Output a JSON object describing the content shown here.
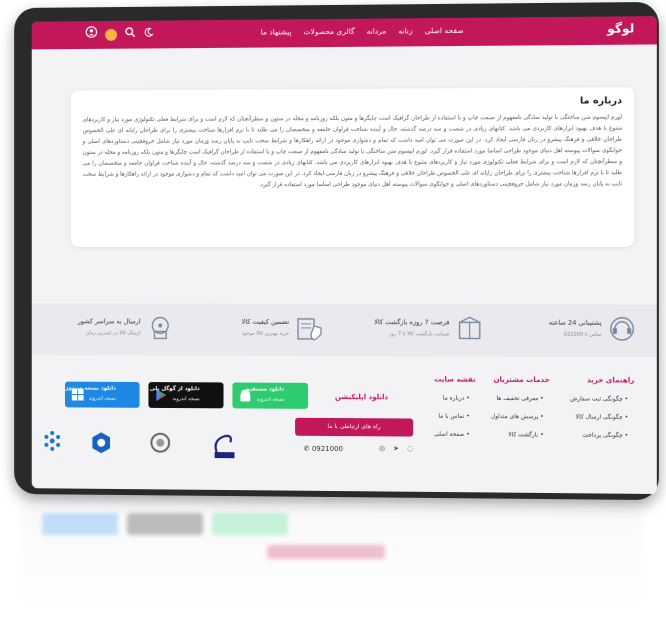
{
  "header": {
    "logo": "لوگو",
    "nav": [
      "صفحه اصلی",
      "زنانه",
      "مردانه",
      "گالری محصولات",
      "پیشنهاد ما"
    ],
    "icons": [
      "user-icon",
      "cart-icon",
      "search-icon",
      "moon-icon"
    ],
    "brand_color": "#c2185b"
  },
  "about": {
    "title": "درباره ما",
    "body": "لورم ایپسوم متن ساختگی با تولید سادگی نامفهوم از صنعت چاپ و با استفاده از طراحان گرافیک است چاپگرها و متون بلکه روزنامه و مجله در ستون و سطرآنچنان که لازم است و برای شرایط فعلی تکنولوژی مورد نیاز و کاربردهای متنوع با هدف بهبود ابزارهای کاربردی می باشد. کتابهای زیادی در شصت و سه درصد گذشته، حال و آینده شناخت فراوان جامعه و متخصصان را می طلبد تا با نرم افزارها شناخت بیشتری را برای طراحان رایانه ای علی الخصوص طراحان خلاقی و فرهنگ پیشرو در زبان فارسی ایجاد کرد. در این صورت می توان امید داشت که تمام و دشواری موجود در ارائه راهکارها و شرایط سخت تایپ به پایان رسد وزمان مورد نیاز شامل حروفچینی دستاوردهای اصلی و جوابگوی سوالات پیوسته اهل دنیای موجود طراحی اساسا مورد استفاده قرار گیرد. لورم ایپسوم متن ساختگی با تولید سادگی نامفهوم از صنعت چاپ و با استفاده از طراحان گرافیک است چاپگرها و متون بلکه روزنامه و مجله در ستون و سطرآنچنان که لازم است و برای شرایط فعلی تکنولوژی مورد نیاز و کاربردهای متنوع با هدف بهبود ابزارهای کاربردی می باشد. کتابهای زیادی در شصت و سه درصد گذشته، حال و آینده شناخت فراوان جامعه و متخصصان را می طلبد تا با نرم افزارها شناخت بیشتری را برای طراحان رایانه ای علی الخصوص طراحان خلاقی و فرهنگ پیشرو در زبان فارسی ایجاد کرد. در این صورت می توان امید داشت که تمام و دشواری موجود در ارائه راهکارها و شرایط سخت تایپ به پایان رسد وزمان مورد نیاز شامل حروفچینی دستاوردهای اصلی و جوابگوی سوالات پیوسته اهل دنیای موجود طراحی اساسا مورد استفاده قرار گیرد."
  },
  "features": [
    {
      "title": "پشتیبانی 24 ساعته",
      "sub": "تماس با 021000",
      "icon": "support-icon"
    },
    {
      "title": "فرصت 7 روزه بازگشت کالا",
      "sub": "ضمانت بازگشت کالا تا 7 روز",
      "icon": "return-box-icon"
    },
    {
      "title": "تضمین کیفیت کالا",
      "sub": "خرید بهترین کالا موجود",
      "icon": "quality-shield-icon"
    },
    {
      "title": "ارسال به سراسر کشور",
      "sub": "ارسال کالا در کمترین زمان",
      "icon": "delivery-icon"
    }
  ],
  "footer": {
    "columns": [
      {
        "title": "راهنمای خرید",
        "items": [
          "چگونگی ثبت سفارش",
          "چگونگی ارسال کالا",
          "چگونگی پرداخت"
        ]
      },
      {
        "title": "خدمات مشتریان",
        "items": [
          "معرفی تخفیف ها",
          "پرسش های متداول",
          "بازگشت کالا"
        ]
      },
      {
        "title": "نقشه سایت",
        "items": [
          "درباره ما",
          "تماس با ما",
          "صفحه اصلی"
        ]
      }
    ],
    "download_title": "دانلود اپلیکیشن",
    "stores": [
      {
        "line1": "دانلود مستقیم",
        "line2": "نسخه اندروید",
        "color": "#2ecc71",
        "icon": "android-icon"
      },
      {
        "line1": "دانلود از گوگل پلی",
        "line2": "نسخه اندروید",
        "color": "#111111",
        "icon": "google-play-icon"
      },
      {
        "line1": "دانلود نسخه ویندوز",
        "line2": "نسخه اندروید",
        "color": "#1e88e5",
        "icon": "windows-icon"
      }
    ],
    "contact_button": "راه های ارتباطی با ما",
    "phone": "0921000",
    "social_icons": [
      "instagram-icon",
      "telegram-icon",
      "whatsapp-icon"
    ],
    "trust_badges": [
      "enamad-badge",
      "samandehi-badge",
      "etehadie-badge",
      "nezam-senfi-badge"
    ]
  }
}
